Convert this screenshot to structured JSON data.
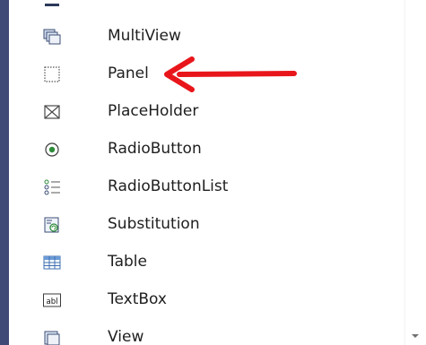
{
  "toolbox": {
    "items": [
      {
        "label": "MultiView",
        "icon": "multiview-icon"
      },
      {
        "label": "Panel",
        "icon": "panel-icon"
      },
      {
        "label": "PlaceHolder",
        "icon": "placeholder-icon"
      },
      {
        "label": "RadioButton",
        "icon": "radiobutton-icon"
      },
      {
        "label": "RadioButtonList",
        "icon": "radiobuttonlist-icon"
      },
      {
        "label": "Substitution",
        "icon": "substitution-icon"
      },
      {
        "label": "Table",
        "icon": "table-icon"
      },
      {
        "label": "TextBox",
        "icon": "textbox-icon",
        "icon_text": "abl"
      },
      {
        "label": "View",
        "icon": "view-icon"
      }
    ]
  },
  "annotation": {
    "type": "arrow",
    "color": "#e8161b",
    "points_to": "Panel"
  },
  "colors": {
    "left_bar": "#3f4a77",
    "text": "#1e1e1e",
    "background": "#ffffff"
  }
}
